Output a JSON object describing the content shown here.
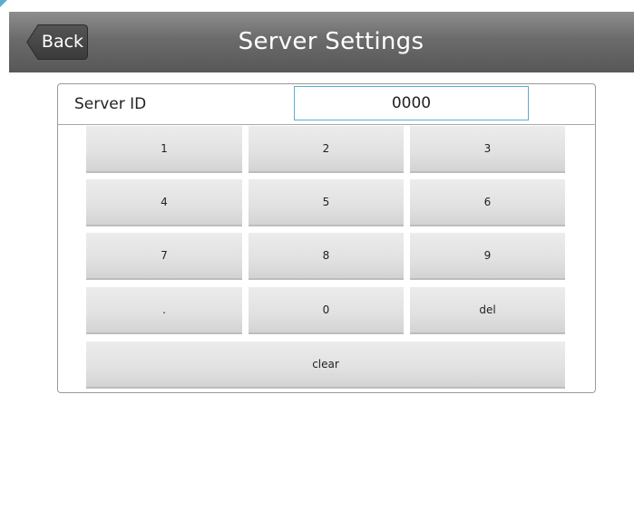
{
  "header": {
    "back_label": "Back",
    "title": "Server Settings"
  },
  "server": {
    "label": "Server ID",
    "value": "0000"
  },
  "keypad": {
    "rows": [
      [
        "1",
        "2",
        "3"
      ],
      [
        "4",
        "5",
        "6"
      ],
      [
        "7",
        "8",
        "9"
      ],
      [
        ".",
        "0",
        "del"
      ]
    ],
    "clear_label": "clear"
  },
  "colors": {
    "header_bar": "#6b6b6b",
    "accent": "#5aaecf",
    "key_face": "#e1e1e1",
    "panel_border": "#9a9a9a"
  }
}
